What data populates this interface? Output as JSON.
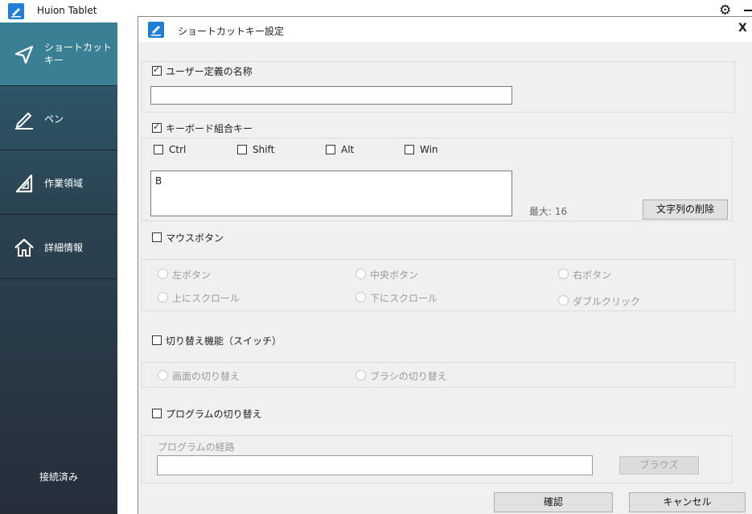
{
  "app": {
    "title": "Huion Tablet",
    "settings_icon": "gear-icon",
    "minimize_icon": "minimize-icon"
  },
  "sidebar": {
    "items": [
      {
        "label": "ショートカット\nキー",
        "icon": "send-arrow-icon"
      },
      {
        "label": "ペン",
        "icon": "pen-icon"
      },
      {
        "label": "作業領域",
        "icon": "set-square-icon"
      },
      {
        "label": "詳細情報",
        "icon": "home-icon"
      }
    ],
    "status": "接続済み"
  },
  "dialog": {
    "title": "ショートカットキー設定",
    "close": "X",
    "user_name": {
      "label": "ユーザー定義の名称",
      "checked": true,
      "value": ""
    },
    "keyboard": {
      "label": "キーボード組合キー",
      "checked": true,
      "modifiers": [
        {
          "label": "Ctrl",
          "checked": false
        },
        {
          "label": "Shift",
          "checked": false
        },
        {
          "label": "Alt",
          "checked": false
        },
        {
          "label": "Win",
          "checked": false
        }
      ],
      "keys_value": "B",
      "max_label": "最大: 16",
      "clear_button": "文字列の削除"
    },
    "mouse": {
      "label": "マウスボタン",
      "checked": false,
      "options": [
        "左ボタン",
        "中央ボタン",
        "右ボタン",
        "上にスクロール",
        "下にスクロール",
        "ダブルクリック"
      ]
    },
    "switch": {
      "label": "切り替え機能（スイッチ）",
      "checked": false,
      "options": [
        "画面の切り替え",
        "ブラシの切り替え"
      ]
    },
    "program": {
      "label": "プログラムの切り替え",
      "checked": false,
      "path_label": "プログラムの経路",
      "path_value": "",
      "browse_button": "ブラウズ"
    },
    "ok_button": "確認",
    "cancel_button": "キャンセル"
  }
}
